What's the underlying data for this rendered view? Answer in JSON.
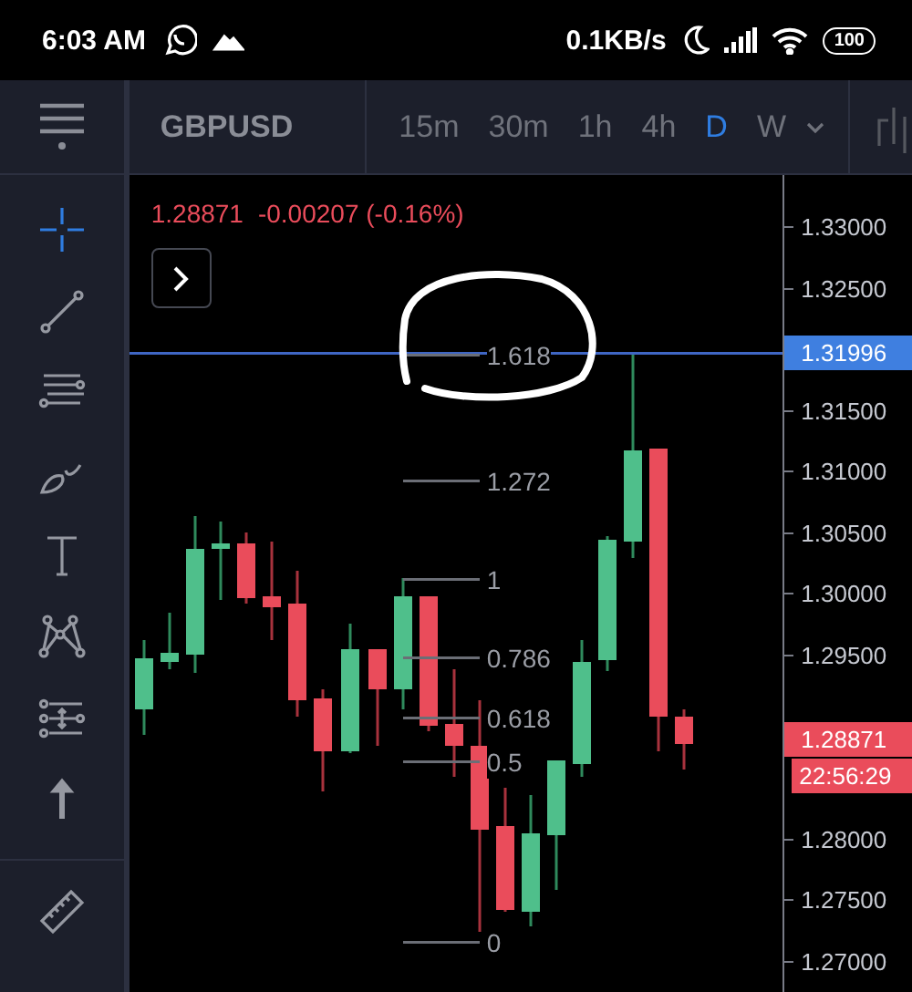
{
  "status_bar": {
    "time": "6:03 AM",
    "net_speed": "0.1KB/s",
    "battery": "100"
  },
  "toolbar": {
    "symbol": "GBPUSD",
    "intervals": [
      {
        "label": "15m",
        "selected": false
      },
      {
        "label": "30m",
        "selected": false
      },
      {
        "label": "1h",
        "selected": false
      },
      {
        "label": "4h",
        "selected": false
      },
      {
        "label": "D",
        "selected": true
      },
      {
        "label": "W",
        "selected": false
      }
    ]
  },
  "sidebar": {
    "tools": [
      {
        "selected": true
      },
      {
        "selected": false
      },
      {
        "selected": false
      },
      {
        "selected": false
      },
      {
        "selected": false
      },
      {
        "selected": false
      },
      {
        "selected": false
      },
      {
        "selected": false
      }
    ]
  },
  "chart": {
    "quote": {
      "price": "1.28871",
      "change": "-0.00207 (-0.16%)"
    },
    "fib_levels": [
      "1.618",
      "1.272",
      "1",
      "0.786",
      "0.618",
      "0.5",
      "0"
    ],
    "price_scale": [
      [
        "1.33000",
        "1.32500"
      ],
      [
        "1.31500",
        "1.31000",
        "1.30500",
        "1.30000",
        "1.29500"
      ],
      [
        "1.28000",
        "1.27500",
        "1.27000"
      ]
    ],
    "crosshair_tag": "1.31996",
    "last_price_tag": "1.28871",
    "countdown": "22:56:29"
  }
}
